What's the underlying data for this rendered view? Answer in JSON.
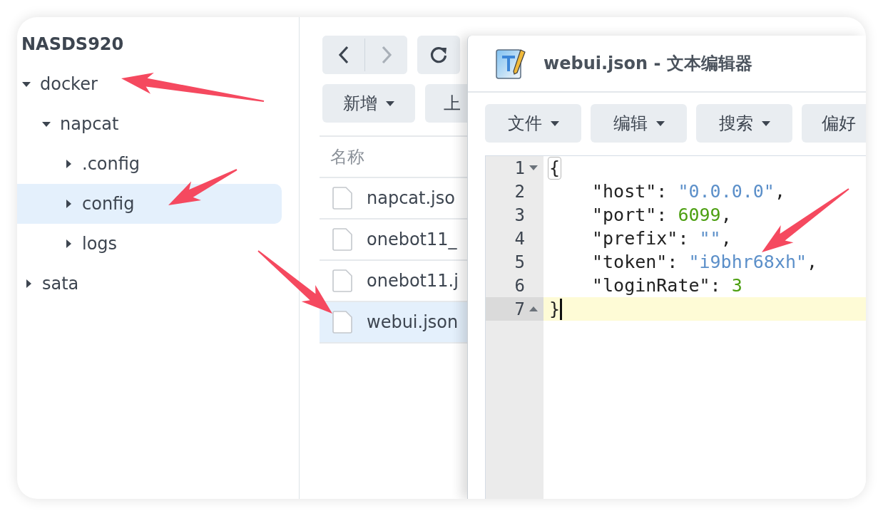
{
  "sidebar": {
    "title": "NASDS920",
    "tree": [
      {
        "label": "docker",
        "expanded": true,
        "selected": false,
        "children": [
          {
            "label": "napcat",
            "expanded": true,
            "selected": false,
            "children": [
              {
                "label": ".config",
                "expanded": false,
                "selected": false
              },
              {
                "label": "config",
                "expanded": false,
                "selected": true
              },
              {
                "label": "logs",
                "expanded": false,
                "selected": false
              }
            ]
          }
        ]
      },
      {
        "label": "sata",
        "expanded": false,
        "selected": false
      }
    ]
  },
  "file_browser": {
    "nav": {
      "back_disabled": false,
      "forward_disabled": true
    },
    "actions": [
      {
        "label": "新增",
        "dropdown": true
      },
      {
        "label": "上",
        "dropdown": false
      }
    ],
    "columns": [
      "名称"
    ],
    "files": [
      {
        "name": "napcat.jso",
        "selected": false
      },
      {
        "name": "onebot11_",
        "selected": false
      },
      {
        "name": "onebot11.j",
        "selected": false
      },
      {
        "name": "webui.json",
        "selected": true
      }
    ]
  },
  "editor": {
    "title": "webui.json - 文本编辑器",
    "menus": [
      {
        "label": "文件",
        "dropdown": true
      },
      {
        "label": "编辑",
        "dropdown": true
      },
      {
        "label": "搜索",
        "dropdown": true
      },
      {
        "label": "偏好",
        "dropdown": false
      }
    ],
    "lines": [
      {
        "number": "1",
        "fold_start": true,
        "fold_end": false,
        "active": false,
        "indented": false,
        "tokens": [
          {
            "kind": "bracket",
            "text": "{"
          }
        ]
      },
      {
        "number": "2",
        "fold_start": false,
        "fold_end": false,
        "active": false,
        "indented": true,
        "tokens": [
          {
            "kind": "plain",
            "text": "\"host\": "
          },
          {
            "kind": "string",
            "text": "\"0.0.0.0\""
          },
          {
            "kind": "plain",
            "text": ","
          }
        ]
      },
      {
        "number": "3",
        "fold_start": false,
        "fold_end": false,
        "active": false,
        "indented": true,
        "tokens": [
          {
            "kind": "plain",
            "text": "\"port\": "
          },
          {
            "kind": "number",
            "text": "6099"
          },
          {
            "kind": "plain",
            "text": ","
          }
        ]
      },
      {
        "number": "4",
        "fold_start": false,
        "fold_end": false,
        "active": false,
        "indented": true,
        "tokens": [
          {
            "kind": "plain",
            "text": "\"prefix\": "
          },
          {
            "kind": "string",
            "text": "\"\""
          },
          {
            "kind": "plain",
            "text": ","
          }
        ]
      },
      {
        "number": "5",
        "fold_start": false,
        "fold_end": false,
        "active": false,
        "indented": true,
        "tokens": [
          {
            "kind": "plain",
            "text": "\"token\": "
          },
          {
            "kind": "string",
            "text": "\"i9bhr68xh\""
          },
          {
            "kind": "plain",
            "text": ","
          }
        ]
      },
      {
        "number": "6",
        "fold_start": false,
        "fold_end": false,
        "active": false,
        "indented": true,
        "tokens": [
          {
            "kind": "plain",
            "text": "\"loginRate\": "
          },
          {
            "kind": "number",
            "text": "3"
          }
        ]
      },
      {
        "number": "7",
        "fold_start": false,
        "fold_end": true,
        "active": true,
        "indented": false,
        "tokens": [
          {
            "kind": "plain",
            "text": "}"
          }
        ]
      }
    ]
  }
}
